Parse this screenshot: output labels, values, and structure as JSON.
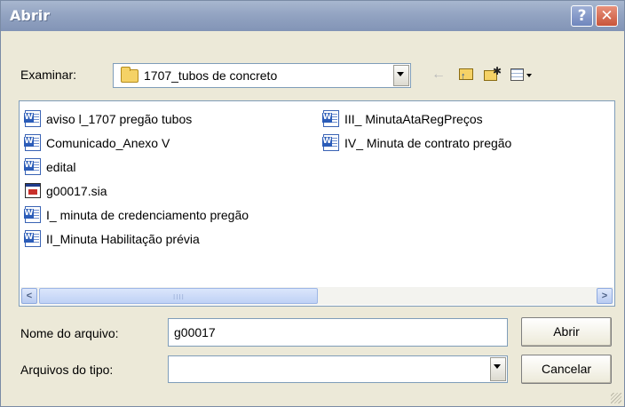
{
  "dialog": {
    "title": "Abrir",
    "help_label": "?",
    "close_label": "✕"
  },
  "lookin": {
    "label": "Examinar:",
    "value": "1707_tubos de concreto"
  },
  "toolbar": {
    "back_icon": "←"
  },
  "files": [
    {
      "name": "aviso l_1707 pregão tubos",
      "type": "doc"
    },
    {
      "name": "Comunicado_Anexo V",
      "type": "doc"
    },
    {
      "name": "edital",
      "type": "doc"
    },
    {
      "name": "g00017.sia",
      "type": "sia"
    },
    {
      "name": "I_ minuta de credenciamento pregão",
      "type": "doc"
    },
    {
      "name": "II_Minuta Habilitação prévia",
      "type": "doc"
    },
    {
      "name": "III_ MinutaAtaRegPreços",
      "type": "doc"
    },
    {
      "name": "IV_ Minuta de contrato pregão",
      "type": "doc"
    }
  ],
  "filename": {
    "label": "Nome do arquivo:",
    "value": "g00017"
  },
  "filetype": {
    "label": "Arquivos do tipo:",
    "value": ""
  },
  "buttons": {
    "open": "Abrir",
    "cancel": "Cancelar"
  },
  "scrollbar": {
    "left_arrow": "<",
    "right_arrow": ">",
    "grip": "IIII"
  }
}
